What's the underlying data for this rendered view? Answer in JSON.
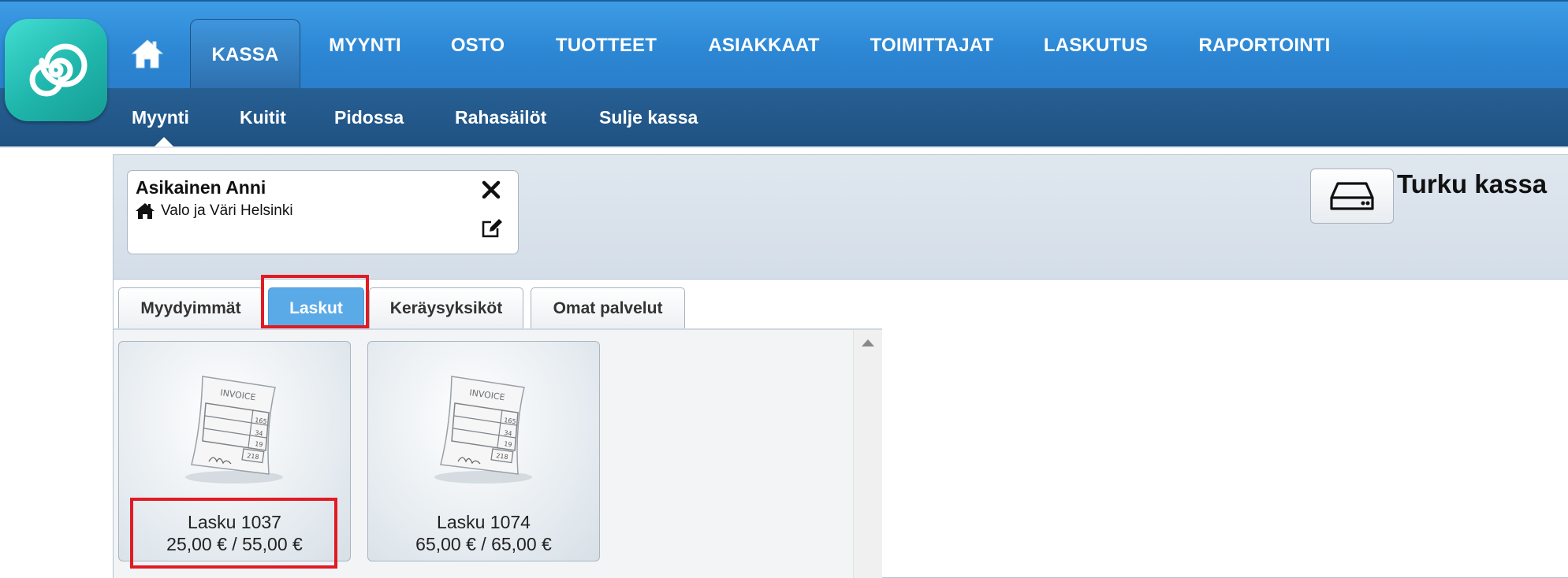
{
  "nav": {
    "home_icon": "home-icon",
    "tabs": [
      {
        "label": "KASSA",
        "active": true
      },
      {
        "label": "MYYNTI"
      },
      {
        "label": "OSTO"
      },
      {
        "label": "TUOTTEET"
      },
      {
        "label": "ASIAKKAAT"
      },
      {
        "label": "TOIMITTAJAT"
      },
      {
        "label": "LASKUTUS"
      },
      {
        "label": "RAPORTOINTI"
      }
    ]
  },
  "subnav": {
    "items": [
      {
        "label": "Myynti",
        "active": true
      },
      {
        "label": "Kuitit"
      },
      {
        "label": "Pidossa"
      },
      {
        "label": "Rahasäilöt"
      },
      {
        "label": "Sulje kassa"
      }
    ]
  },
  "customer": {
    "name": "Asikainen Anni",
    "store": "Valo ja Väri Helsinki"
  },
  "register": {
    "name": "Turku kassa"
  },
  "tabs": [
    {
      "label": "Myydyimmät"
    },
    {
      "label": "Laskut",
      "active": true
    },
    {
      "label": "Keräysyksiköt"
    },
    {
      "label": "Omat palvelut"
    }
  ],
  "invoices": [
    {
      "title": "Lasku 1037",
      "amount": "25,00 € / 55,00 €"
    },
    {
      "title": "Lasku 1074",
      "amount": "65,00 € / 65,00 €"
    }
  ],
  "invoice_image_text": {
    "header": "INVOICE",
    "values": [
      "165",
      "34",
      "19",
      "218"
    ]
  },
  "colors": {
    "nav_blue": "#2c86d3",
    "subnav_blue": "#1f5282",
    "active_tab": "#5baae8",
    "highlight": "#e01b24",
    "logo_teal": "#1fb6ac"
  }
}
